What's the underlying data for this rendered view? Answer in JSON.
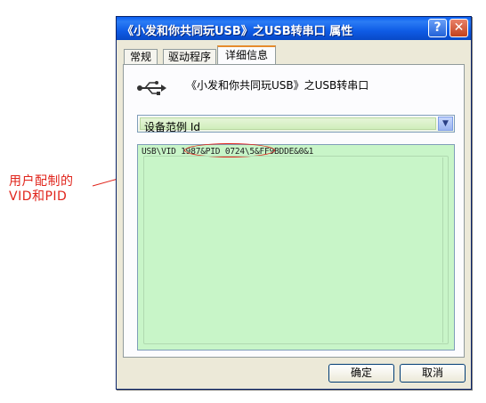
{
  "window": {
    "title": "《小发和你共同玩USB》之USB转串口 属性",
    "help_label": "?",
    "close_label": "✕"
  },
  "tabs": [
    {
      "label": "常规",
      "active": false
    },
    {
      "label": "驱动程序",
      "active": false
    },
    {
      "label": "详细信息",
      "active": true
    }
  ],
  "device": {
    "icon": "usb-icon",
    "name": "《小发和你共同玩USB》之USB转串口"
  },
  "property_select": {
    "selected": "设备范例 Id"
  },
  "value_list": {
    "items": [
      "USB\\VID_1987&PID_0724\\5&FF9BDDE&0&1"
    ]
  },
  "buttons": {
    "ok": "确定",
    "cancel": "取消"
  },
  "annotation": {
    "line1": "用户配制的",
    "line2": "VID和PID",
    "color": "#e0241b"
  }
}
